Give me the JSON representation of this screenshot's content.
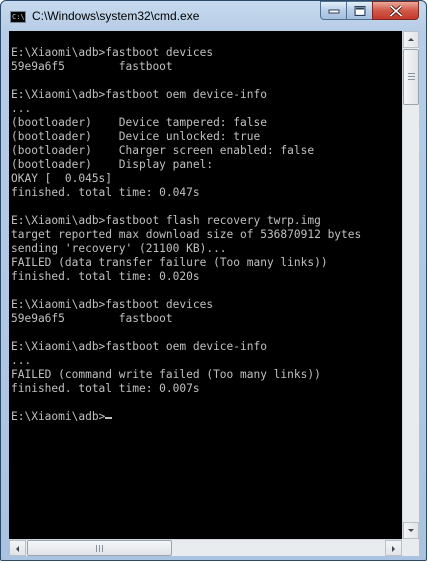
{
  "window": {
    "title": "C:\\Windows\\system32\\cmd.exe",
    "icon_text": "C:\\",
    "icon": "cmd-icon",
    "controls": [
      "minimize-icon",
      "maximize-icon",
      "close-icon"
    ]
  },
  "colors": {
    "console_bg": "#000000",
    "console_fg": "#c0c0c0",
    "close_button": "#c4382a",
    "frame": "#b7cde6"
  },
  "console": {
    "lines": [
      "",
      "E:\\Xiaomi\\adb>fastboot devices",
      "59e9a6f5        fastboot",
      "",
      "E:\\Xiaomi\\adb>fastboot oem device-info",
      "...",
      "(bootloader)    Device tampered: false",
      "(bootloader)    Device unlocked: true",
      "(bootloader)    Charger screen enabled: false",
      "(bootloader)    Display panel:",
      "OKAY [  0.045s]",
      "finished. total time: 0.047s",
      "",
      "E:\\Xiaomi\\adb>fastboot flash recovery twrp.img",
      "target reported max download size of 536870912 bytes",
      "sending 'recovery' (21100 KB)...",
      "FAILED (data transfer failure (Too many links))",
      "finished. total time: 0.020s",
      "",
      "E:\\Xiaomi\\adb>fastboot devices",
      "59e9a6f5        fastboot",
      "",
      "E:\\Xiaomi\\adb>fastboot oem device-info",
      "...",
      "FAILED (command write failed (Too many links))",
      "finished. total time: 0.007s",
      "",
      "E:\\Xiaomi\\adb>"
    ]
  },
  "scrollbars": {
    "vertical_position": 0,
    "horizontal_position": 0
  }
}
